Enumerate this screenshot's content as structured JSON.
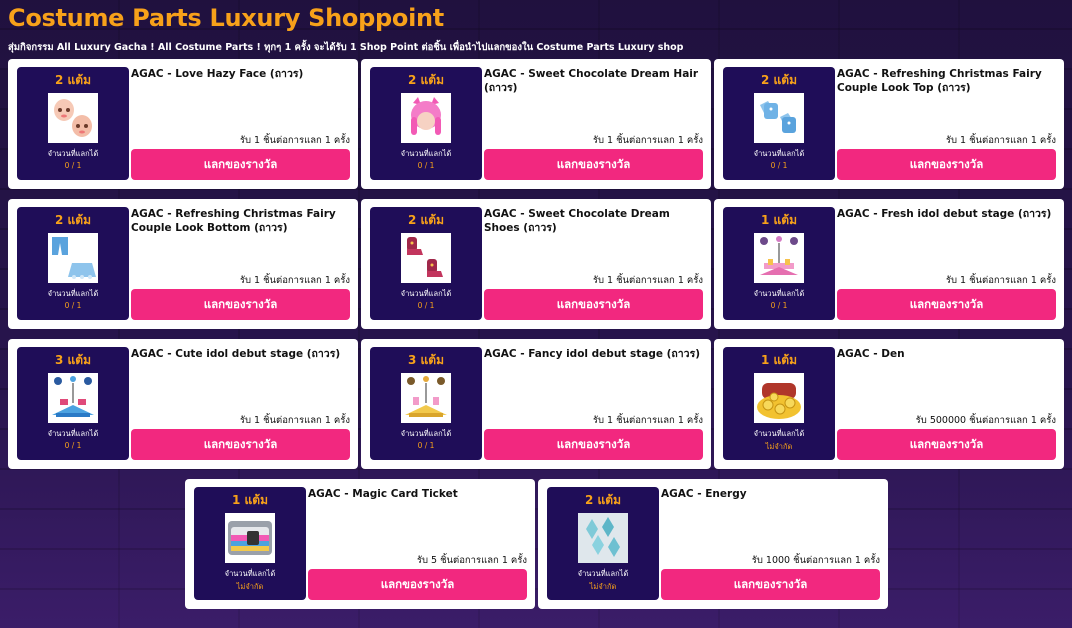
{
  "header": {
    "title": "Costume Parts Luxury Shoppoint",
    "subtitle": "สุ่มกิจกรรม All Luxury Gacha ! All Costume Parts ! ทุกๆ 1 ครั้ง จะได้รับ 1 Shop Point ต่อชิ้น เพื่อนำไปแลกของใน Costume Parts Luxury shop"
  },
  "colors": {
    "accent": "#f7a11a",
    "button": "#f2287f",
    "panel": "#1f0d58"
  },
  "items": [
    {
      "points": "2 แต้ม",
      "name": "AGAC - Love Hazy Face (ถาวร)",
      "rate": "รับ 1 ชิ้นต่อการแลก 1 ครั้ง",
      "redeem_label": "จำนวนที่แลกได้",
      "redeem_value": "0 / 1",
      "button": "แลกของรางวัล",
      "icon": "hazy-face-icon"
    },
    {
      "points": "2 แต้ม",
      "name": "AGAC - Sweet Chocolate Dream Hair (ถาวร)",
      "rate": "รับ 1 ชิ้นต่อการแลก 1 ครั้ง",
      "redeem_label": "จำนวนที่แลกได้",
      "redeem_value": "0 / 1",
      "button": "แลกของรางวัล",
      "icon": "pink-hair-icon"
    },
    {
      "points": "2 แต้ม",
      "name": "AGAC - Refreshing Christmas Fairy Couple Look Top (ถาวร)",
      "rate": "รับ 1 ชิ้นต่อการแลก 1 ครั้ง",
      "redeem_label": "จำนวนที่แลกได้",
      "redeem_value": "0 / 1",
      "button": "แลกของรางวัล",
      "icon": "blue-top-icon"
    },
    {
      "points": "2 แต้ม",
      "name": "AGAC - Refreshing Christmas Fairy Couple Look Bottom (ถาวร)",
      "rate": "รับ 1 ชิ้นต่อการแลก 1 ครั้ง",
      "redeem_label": "จำนวนที่แลกได้",
      "redeem_value": "0 / 1",
      "button": "แลกของรางวัล",
      "icon": "blue-bottom-icon"
    },
    {
      "points": "2 แต้ม",
      "name": "AGAC - Sweet Chocolate Dream Shoes (ถาวร)",
      "rate": "รับ 1 ชิ้นต่อการแลก 1 ครั้ง",
      "redeem_label": "จำนวนที่แลกได้",
      "redeem_value": "0 / 1",
      "button": "แลกของรางวัล",
      "icon": "shoes-icon"
    },
    {
      "points": "1 แต้ม",
      "name": "AGAC - Fresh idol debut stage (ถาวร)",
      "rate": "รับ 1 ชิ้นต่อการแลก 1 ครั้ง",
      "redeem_label": "จำนวนที่แลกได้",
      "redeem_value": "0 / 1",
      "button": "แลกของรางวัล",
      "icon": "idol-stage-pink-icon"
    },
    {
      "points": "3 แต้ม",
      "name": "AGAC - Cute idol debut stage (ถาวร)",
      "rate": "รับ 1 ชิ้นต่อการแลก 1 ครั้ง",
      "redeem_label": "จำนวนที่แลกได้",
      "redeem_value": "0 / 1",
      "button": "แลกของรางวัล",
      "icon": "idol-stage-blue-icon"
    },
    {
      "points": "3 แต้ม",
      "name": "AGAC - Fancy idol debut stage (ถาวร)",
      "rate": "รับ 1 ชิ้นต่อการแลก 1 ครั้ง",
      "redeem_label": "จำนวนที่แลกได้",
      "redeem_value": "0 / 1",
      "button": "แลกของรางวัล",
      "icon": "idol-stage-gold-icon"
    },
    {
      "points": "1 แต้ม",
      "name": "AGAC - Den",
      "rate": "รับ 500000 ชิ้นต่อการแลก 1 ครั้ง",
      "redeem_label": "จำนวนที่แลกได้",
      "redeem_value": "ไม่จำกัด",
      "button": "แลกของรางวัล",
      "icon": "gold-coins-icon"
    },
    {
      "points": "1 แต้ม",
      "name": "AGAC - Magic Card Ticket",
      "rate": "รับ 5 ชิ้นต่อการแลก 1 ครั้ง",
      "redeem_label": "จำนวนที่แลกได้",
      "redeem_value": "ไม่จำกัด",
      "button": "แลกของรางวัล",
      "icon": "magic-card-icon"
    },
    {
      "points": "2 แต้ม",
      "name": "AGAC - Energy",
      "rate": "รับ 1000 ชิ้นต่อการแลก 1 ครั้ง",
      "redeem_label": "จำนวนที่แลกได้",
      "redeem_value": "ไม่จำกัด",
      "button": "แลกของรางวัล",
      "icon": "energy-crystals-icon"
    }
  ]
}
